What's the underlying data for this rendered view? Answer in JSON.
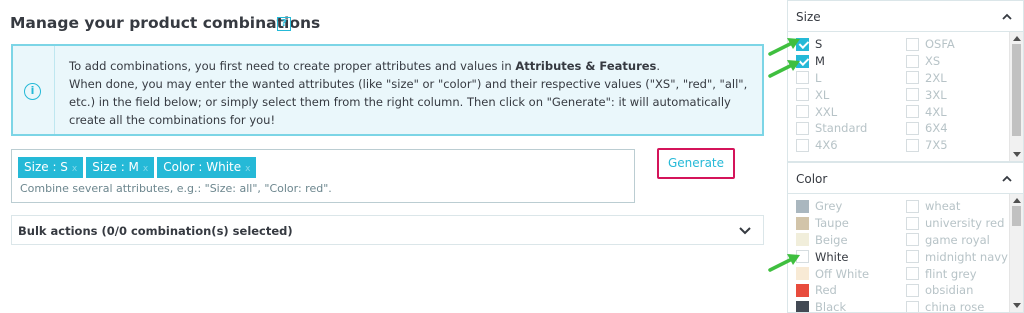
{
  "main": {
    "title": "Manage your product combinations",
    "help_label": "?",
    "info_icon": "info-circle-icon",
    "info_line1_pre": "To add combinations, you first need to create proper attributes and values in ",
    "info_line1_bold": "Attributes & Features",
    "info_line1_post": ".",
    "info_rest": "When done, you may enter the wanted attributes (like \"size\" or \"color\") and their respective values (\"XS\", \"red\", \"all\", etc.) in the field below; or simply select them from the right column. Then click on \"Generate\": it will automatically create all the combinations for you!",
    "tags": [
      {
        "label": "Size : S",
        "remove": "x"
      },
      {
        "label": "Size : M",
        "remove": "x"
      },
      {
        "label": "Color : White",
        "remove": "x"
      }
    ],
    "tag_hint": "Combine several attributes, e.g.: \"Size: all\", \"Color: red\".",
    "generate_label": "Generate",
    "bulk_label": "Bulk actions (0/0 combination(s) selected)"
  },
  "size_panel": {
    "title": "Size",
    "left": [
      {
        "label": "S",
        "checked": true
      },
      {
        "label": "M",
        "checked": true
      },
      {
        "label": "L",
        "checked": false
      },
      {
        "label": "XL",
        "checked": false
      },
      {
        "label": "XXL",
        "checked": false
      },
      {
        "label": "Standard",
        "checked": false
      },
      {
        "label": "4X6",
        "checked": false
      }
    ],
    "right": [
      {
        "label": "OSFA",
        "checked": false
      },
      {
        "label": "XS",
        "checked": false
      },
      {
        "label": "2XL",
        "checked": false
      },
      {
        "label": "3XL",
        "checked": false
      },
      {
        "label": "4XL",
        "checked": false
      },
      {
        "label": "6X4",
        "checked": false
      },
      {
        "label": "7X5",
        "checked": false
      }
    ]
  },
  "color_panel": {
    "title": "Color",
    "left": [
      {
        "label": "Grey",
        "swatch": "#aab7bf",
        "on": false
      },
      {
        "label": "Taupe",
        "swatch": "#d2c4a9",
        "on": false
      },
      {
        "label": "Beige",
        "swatch": "#f1eedb",
        "on": false
      },
      {
        "label": "White",
        "swatch": "#ffffff",
        "on": true
      },
      {
        "label": "Off White",
        "swatch": "#f8ead5",
        "on": false
      },
      {
        "label": "Red",
        "swatch": "#e84c3d",
        "on": false
      },
      {
        "label": "Black",
        "swatch": "#434a54",
        "on": false
      }
    ],
    "right": [
      {
        "label": "wheat"
      },
      {
        "label": "university red"
      },
      {
        "label": "game royal"
      },
      {
        "label": "midnight navy"
      },
      {
        "label": "flint grey"
      },
      {
        "label": "obsidian"
      },
      {
        "label": "china rose"
      }
    ]
  },
  "colors": {
    "accent": "#25b9d7",
    "highlight_border": "#d4145a",
    "annotation_arrow": "#3fbf3f"
  }
}
